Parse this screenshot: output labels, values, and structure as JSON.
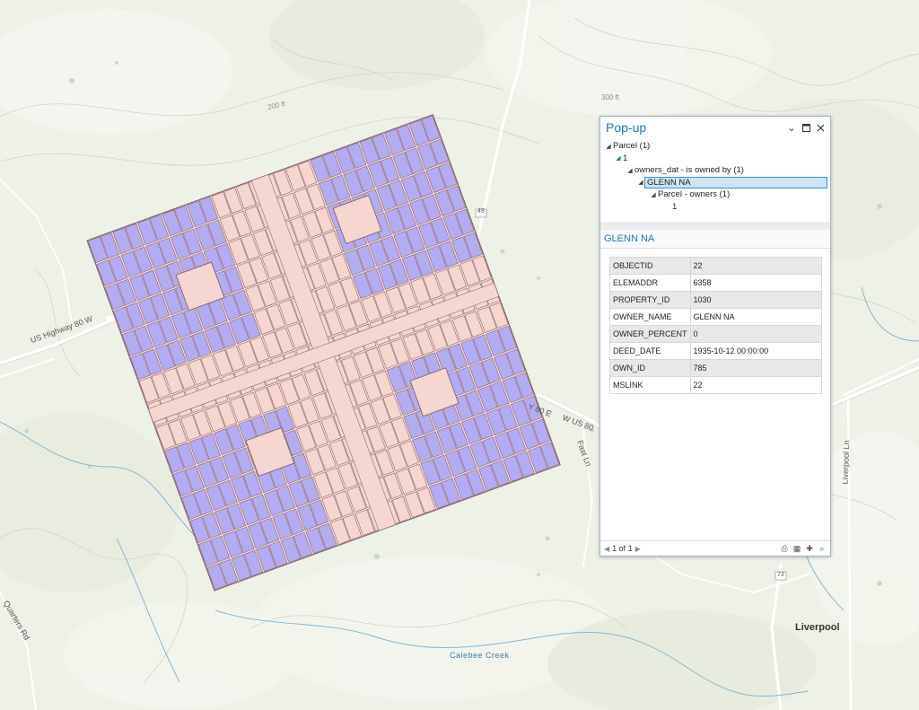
{
  "map": {
    "place_labels": [
      {
        "id": "liverpool",
        "text": "Liverpool"
      }
    ],
    "road_labels": [
      {
        "id": "us-highway-80-w",
        "text": "US Highway 80 W"
      },
      {
        "id": "rt-49",
        "text": "49"
      },
      {
        "id": "us80-e",
        "text": "Y 80 E"
      },
      {
        "id": "w-us80",
        "text": "W US 80"
      },
      {
        "id": "fast-ln",
        "text": "Fast Ln"
      },
      {
        "id": "liverpool-ln",
        "text": "Liverpool Ln"
      },
      {
        "id": "rt-73",
        "text": "73"
      },
      {
        "id": "quarters-rd",
        "text": "Quarters Rd"
      }
    ],
    "contour_labels": [
      {
        "id": "c200",
        "text": "200 ft"
      },
      {
        "id": "c300",
        "text": "300 ft"
      }
    ],
    "water_labels": [
      {
        "id": "calebee-creek",
        "text": "Calebee Creek"
      }
    ],
    "colors": {
      "parcel_owned": "#b3acf2",
      "parcel_other": "#f6d6cf",
      "parcel_outline": "#7a5560",
      "background": "#eef1e6",
      "water": "#7fb6d5",
      "road": "#ffffff"
    }
  },
  "popup": {
    "title": "Pop-up",
    "tree": [
      {
        "level": 0,
        "caret": "open",
        "text": "Parcel  (1)"
      },
      {
        "level": 1,
        "caret": "closed-filled",
        "text": "1"
      },
      {
        "level": 2,
        "caret": "open",
        "text": "owners_dat - is owned by  (1)"
      },
      {
        "level": 3,
        "caret": "open",
        "text": "GLENN NA",
        "selected": true
      },
      {
        "level": 4,
        "caret": "open",
        "text": "Parcel - owners  (1)"
      },
      {
        "level": 5,
        "caret": "none",
        "text": "1"
      }
    ],
    "feature_title": "GLENN NA",
    "attributes": [
      {
        "key": "OBJECTID",
        "value": "22"
      },
      {
        "key": "ELEMADDR",
        "value": "6358"
      },
      {
        "key": "PROPERTY_ID",
        "value": "1030"
      },
      {
        "key": "OWNER_NAME",
        "value": "GLENN NA"
      },
      {
        "key": "OWNER_PERCENT",
        "value": "0"
      },
      {
        "key": "DEED_DATE",
        "value": "1935-10-12 00:00:00"
      },
      {
        "key": "OWN_ID",
        "value": "785"
      },
      {
        "key": "MSLINK",
        "value": "22"
      }
    ],
    "pager": "1 of 1",
    "header_icons": [
      "chevron-down-icon",
      "maximize-icon",
      "close-icon"
    ],
    "footer_icons": [
      "print-icon",
      "export-icon",
      "zoom-to-icon",
      "flash-icon"
    ]
  }
}
